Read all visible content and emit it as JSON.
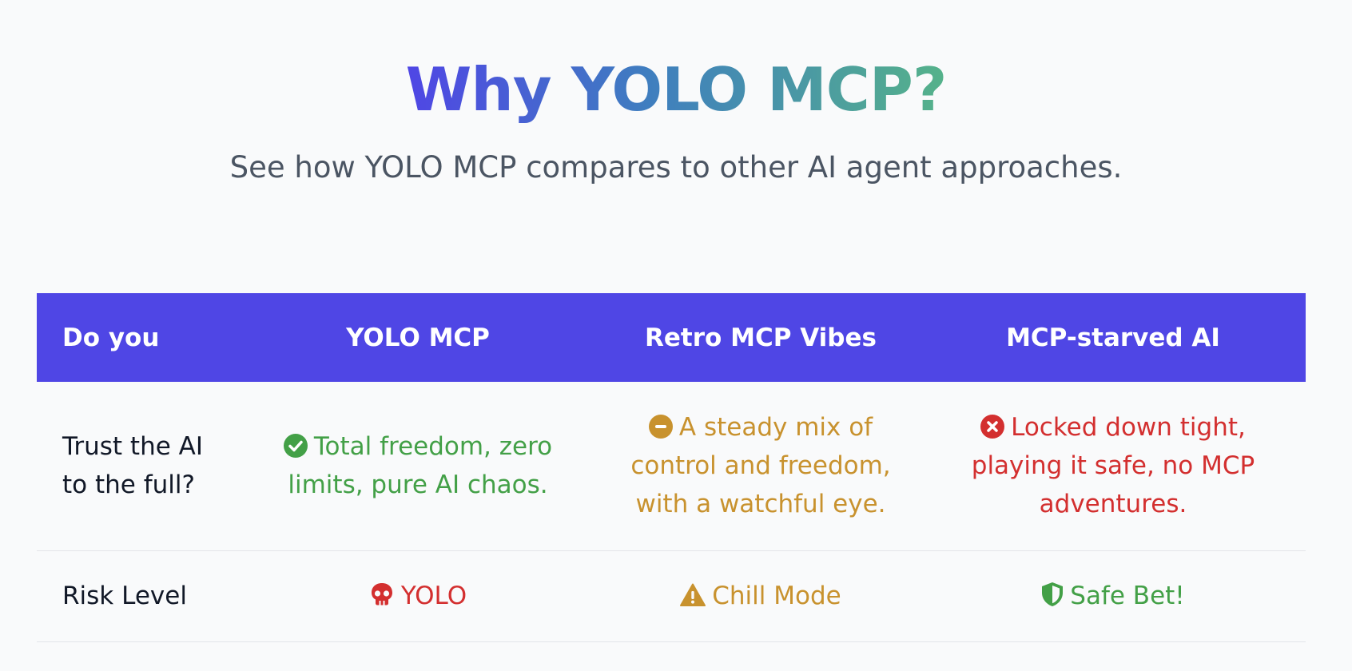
{
  "header": {
    "title": "Why YOLO MCP?",
    "subtitle": "See how YOLO MCP compares to other AI agent approaches."
  },
  "table": {
    "columns": [
      "Do you",
      "YOLO MCP",
      "Retro MCP Vibes",
      "MCP-starved AI"
    ],
    "rows": [
      {
        "label": "Trust the AI to the full?",
        "cells": [
          {
            "text": "Total freedom, zero limits, pure AI chaos.",
            "icon": "check-circle-icon",
            "color": "#43a047"
          },
          {
            "text": "A steady mix of control and freedom, with a watchful eye.",
            "icon": "minus-circle-icon",
            "color": "#c8922e"
          },
          {
            "text": "Locked down tight, playing it safe, no MCP adventures.",
            "icon": "x-circle-icon",
            "color": "#d32f2f"
          }
        ]
      },
      {
        "label": "Risk Level",
        "cells": [
          {
            "text": "YOLO",
            "icon": "skull-icon",
            "color": "#d32f2f"
          },
          {
            "text": "Chill Mode",
            "icon": "warning-triangle-icon",
            "color": "#c8922e"
          },
          {
            "text": "Safe Bet!",
            "icon": "shield-icon",
            "color": "#43a047"
          }
        ]
      }
    ]
  },
  "colors": {
    "header_bg": "#4f46e5",
    "gradient": [
      "#4f46e5",
      "#3f7ebf",
      "#55b28a"
    ],
    "positive": "#43a047",
    "neutral": "#c8922e",
    "negative": "#d32f2f"
  }
}
